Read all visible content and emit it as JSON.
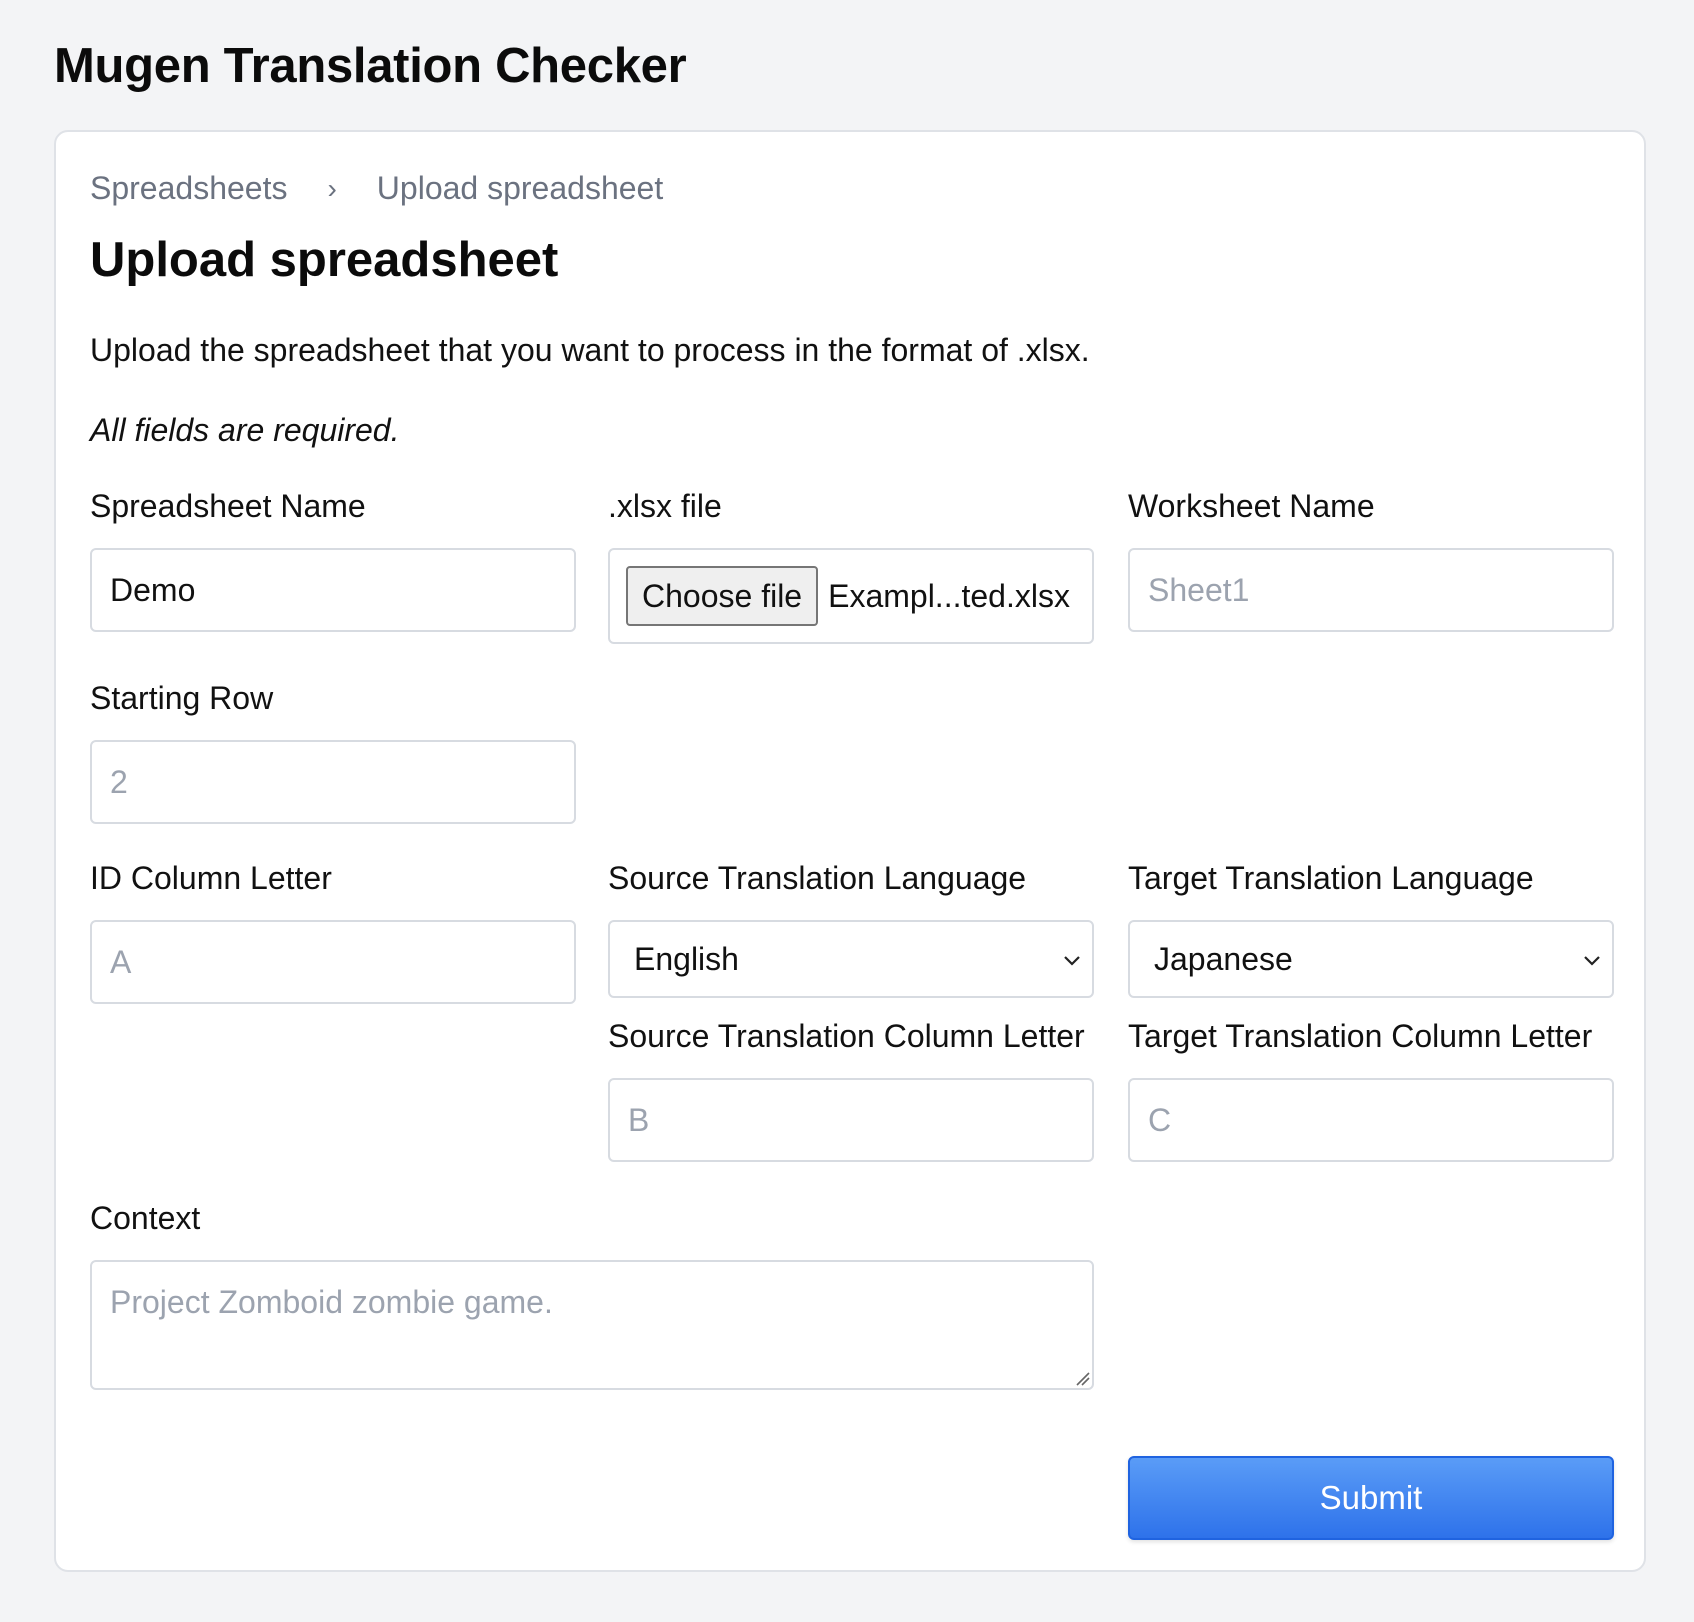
{
  "app_title": "Mugen Translation Checker",
  "breadcrumb": {
    "items": [
      "Spreadsheets",
      "Upload spreadsheet"
    ],
    "separator": "›"
  },
  "page": {
    "title": "Upload spreadsheet",
    "description": "Upload the spreadsheet that you want to process in the format of .xlsx.",
    "required_note": "All fields are required."
  },
  "form": {
    "spreadsheet_name": {
      "label": "Spreadsheet Name",
      "value": "Demo"
    },
    "xlsx_file": {
      "label": ".xlsx file",
      "button_label": "Choose file",
      "file_name": "Exampl...ted.xlsx"
    },
    "worksheet_name": {
      "label": "Worksheet Name",
      "placeholder": "Sheet1"
    },
    "starting_row": {
      "label": "Starting Row",
      "placeholder": "2"
    },
    "id_column_letter": {
      "label": "ID Column Letter",
      "placeholder": "A"
    },
    "source_language": {
      "label": "Source Translation Language",
      "selected": "English"
    },
    "target_language": {
      "label": "Target Translation Language",
      "selected": "Japanese"
    },
    "source_column_letter": {
      "label": "Source Translation Column Letter",
      "placeholder": "B"
    },
    "target_column_letter": {
      "label": "Target Translation Column Letter",
      "placeholder": "C"
    },
    "context": {
      "label": "Context",
      "placeholder": "Project Zomboid zombie game."
    },
    "submit_label": "Submit"
  },
  "colors": {
    "page_background": "#f3f4f6",
    "submit_button": "#2e72ea",
    "placeholder_text": "#9ca3af",
    "muted_text": "#6b7280"
  }
}
